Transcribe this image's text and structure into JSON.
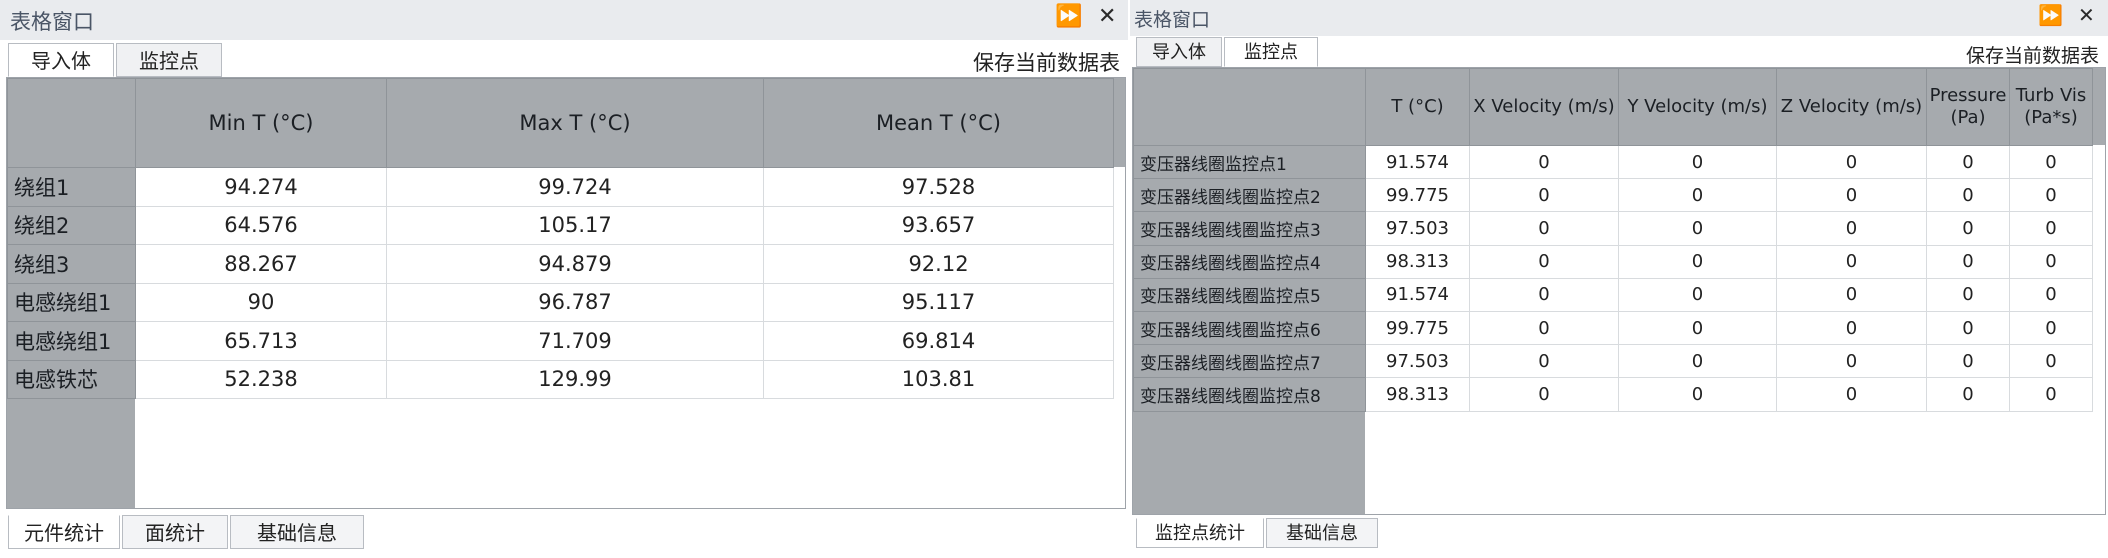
{
  "left": {
    "title": "表格窗口",
    "controls": {
      "pin": "⏩",
      "close": "✕"
    },
    "tabs": [
      "导入体",
      "监控点"
    ],
    "save_label": "保存当前数据表",
    "columns": [
      "Min T (°C)",
      "Max T (°C)",
      "Mean T (°C)"
    ],
    "rows": [
      {
        "name": "绕组1",
        "values": [
          "94.274",
          "99.724",
          "97.528"
        ]
      },
      {
        "name": "绕组2",
        "values": [
          "64.576",
          "105.17",
          "93.657"
        ]
      },
      {
        "name": "绕组3",
        "values": [
          "88.267",
          "94.879",
          "92.12"
        ]
      },
      {
        "name": "电感绕组1",
        "values": [
          "90",
          "96.787",
          "95.117"
        ]
      },
      {
        "name": "电感绕组1",
        "values": [
          "65.713",
          "71.709",
          "69.814"
        ]
      },
      {
        "name": "电感铁芯",
        "values": [
          "52.238",
          "129.99",
          "103.81"
        ]
      }
    ],
    "bottom_tabs": [
      "元件统计",
      "面统计",
      "基础信息"
    ]
  },
  "right": {
    "title": "表格窗口",
    "controls": {
      "pin": "⏩",
      "close": "✕"
    },
    "tabs": [
      "导入体",
      "监控点"
    ],
    "save_label": "保存当前数据表",
    "columns": [
      {
        "line1": "T (°C)",
        "line2": ""
      },
      {
        "line1": "X Velocity (m/s)",
        "line2": ""
      },
      {
        "line1": "Y Velocity (m/s)",
        "line2": ""
      },
      {
        "line1": "Z Velocity (m/s)",
        "line2": ""
      },
      {
        "line1": "Pressure",
        "line2": "(Pa)"
      },
      {
        "line1": "Turb Vis",
        "line2": "(Pa*s)"
      }
    ],
    "rows": [
      {
        "name": "变压器线圈监控点1",
        "values": [
          "91.574",
          "0",
          "0",
          "0",
          "0",
          "0"
        ]
      },
      {
        "name": "变压器线圈线圈监控点2",
        "values": [
          "99.775",
          "0",
          "0",
          "0",
          "0",
          "0"
        ]
      },
      {
        "name": "变压器线圈线圈监控点3",
        "values": [
          "97.503",
          "0",
          "0",
          "0",
          "0",
          "0"
        ]
      },
      {
        "name": "变压器线圈线圈监控点4",
        "values": [
          "98.313",
          "0",
          "0",
          "0",
          "0",
          "0"
        ]
      },
      {
        "name": "变压器线圈线圈监控点5",
        "values": [
          "91.574",
          "0",
          "0",
          "0",
          "0",
          "0"
        ]
      },
      {
        "name": "变压器线圈线圈监控点6",
        "values": [
          "99.775",
          "0",
          "0",
          "0",
          "0",
          "0"
        ]
      },
      {
        "name": "变压器线圈线圈监控点7",
        "values": [
          "97.503",
          "0",
          "0",
          "0",
          "0",
          "0"
        ]
      },
      {
        "name": "变压器线圈线圈监控点8",
        "values": [
          "98.313",
          "0",
          "0",
          "0",
          "0",
          "0"
        ]
      }
    ],
    "bottom_tabs": [
      "监控点统计",
      "基础信息"
    ]
  }
}
